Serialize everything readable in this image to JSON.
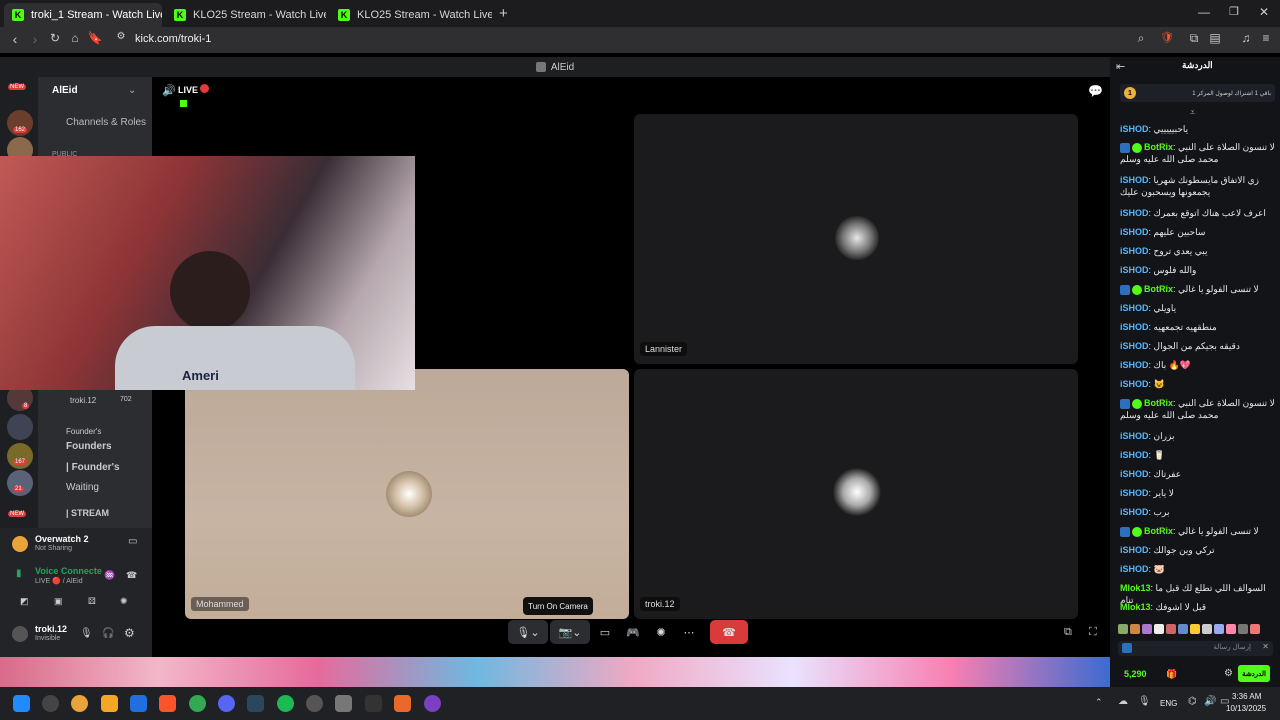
{
  "browser": {
    "tabs": [
      {
        "title": "troki_1 Stream - Watch Live on K",
        "active": true
      },
      {
        "title": "KLO25 Stream - Watch Live on Kick",
        "active": false
      },
      {
        "title": "KLO25 Stream - Watch Live on Kick",
        "active": false
      }
    ],
    "url": "kick.com/troki-1"
  },
  "discord": {
    "window_title": "AlEid",
    "server_name": "AlEid",
    "live_label": "LIVE",
    "menu_channels_roles": "Channels & Roles",
    "public_label": "PUBLIC",
    "server_badges": [
      "NEW",
      "162",
      "8",
      "167",
      "21",
      "NEW"
    ],
    "member_row": "troki.12",
    "member_badge": "702",
    "founder_category": "Founder's",
    "channels": [
      "Founders",
      "| Founder's",
      "Waiting",
      "| STREAM"
    ],
    "game": {
      "name": "Overwatch 2",
      "status": "Not Sharing"
    },
    "voice": {
      "status": "Voice Connecte",
      "sub": "LIVE 🔴 / AlEid"
    },
    "user": {
      "name": "troki.12",
      "status": "Invisible"
    },
    "tiles": [
      {
        "label": "Lannister"
      },
      {
        "label": "Mohammed"
      },
      {
        "label": "troki.12"
      }
    ],
    "tooltip": "Turn On Camera",
    "cam_text": "Ameri"
  },
  "chat": {
    "header": "الدردشة",
    "pinned": "باقي 1 اشتراك لوصول المركز 1",
    "pinned_rank": "1",
    "messages": [
      {
        "user": "iSHOD",
        "text": "ياحبيييييي",
        "bot": false
      },
      {
        "user": "BotRix",
        "text": "لا تنسون الصلاة على النبي محمد صلى الله عليه وسلم",
        "bot": true
      },
      {
        "user": "iSHOD",
        "text": "زي الاتفاق مايسطونك شهريا يجمعونها ويسحبون عليك",
        "bot": false
      },
      {
        "user": "iSHOD",
        "text": "اعرف لاعب هناك اتوقع بعمرك",
        "bot": false
      },
      {
        "user": "iSHOD",
        "text": "ساحبين عليهم",
        "bot": false
      },
      {
        "user": "iSHOD",
        "text": "يبي يعدي تروح",
        "bot": false
      },
      {
        "user": "iSHOD",
        "text": "والله فلوس",
        "bot": false
      },
      {
        "user": "BotRix",
        "text": "لا تنسى الفولو يا غالي",
        "bot": true
      },
      {
        "user": "iSHOD",
        "text": "ياويلي",
        "bot": false
      },
      {
        "user": "iSHOD",
        "text": "منطقهيه تجمعهيه",
        "bot": false
      },
      {
        "user": "iSHOD",
        "text": "دقيقه بجيكم من الجوال",
        "bot": false
      },
      {
        "user": "iSHOD",
        "text": "باك 🔥💖",
        "bot": false
      },
      {
        "user": "iSHOD",
        "text": "😺",
        "bot": false
      },
      {
        "user": "BotRix",
        "text": "لا تنسون الصلاة على النبي محمد صلى الله عليه وسلم",
        "bot": true
      },
      {
        "user": "iSHOD",
        "text": "بزران",
        "bot": false
      },
      {
        "user": "iSHOD",
        "text": "🥛",
        "bot": false
      },
      {
        "user": "iSHOD",
        "text": "عفرتاك",
        "bot": false
      },
      {
        "user": "iSHOD",
        "text": "لا ياير",
        "bot": false
      },
      {
        "user": "iSHOD",
        "text": "برب",
        "bot": false
      },
      {
        "user": "BotRix",
        "text": "لا تنسى الفولو يا غالي",
        "bot": true
      },
      {
        "user": "iSHOD",
        "text": "تركي وين جوالك",
        "bot": false
      },
      {
        "user": "iSHOD",
        "text": "🐷",
        "bot": false
      },
      {
        "user": "Mlok13",
        "text": "السوالف اللي تطلع لك قبل ما تنام",
        "bot": false
      },
      {
        "user": "Mlok13",
        "text": "قبل لا اشوفك",
        "bot": false
      }
    ],
    "input_placeholder": "إرسال رسالة",
    "points": "5,290",
    "send_label": "الدردشة"
  },
  "taskbar": {
    "time": "3:36 AM",
    "date": "10/13/2025",
    "lang": "ENG"
  },
  "colors": {
    "kick_green": "#53fc18",
    "chat_user": "#53b8ff",
    "end_call": "#d93b3b"
  }
}
